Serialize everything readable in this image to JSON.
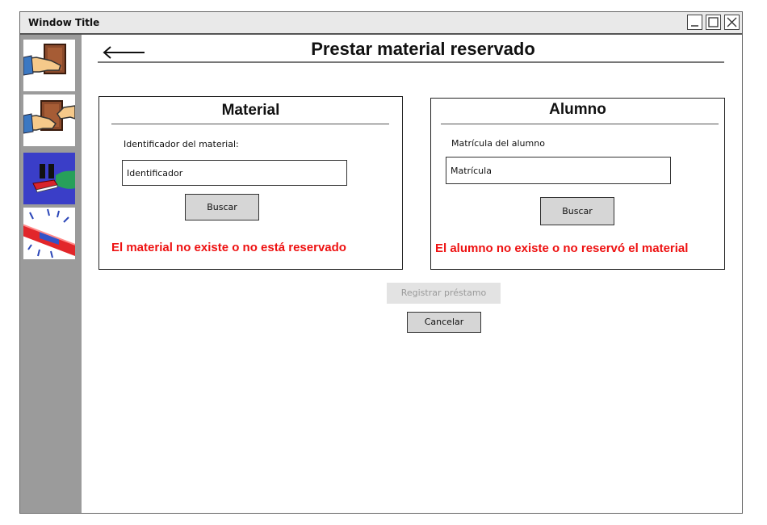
{
  "window": {
    "title": "Window Title"
  },
  "sidebar": {
    "items": [
      {
        "name": "lend-book-icon"
      },
      {
        "name": "return-book-icon"
      },
      {
        "name": "pause-book-icon"
      },
      {
        "name": "alert-siren-icon"
      }
    ]
  },
  "header": {
    "title": "Prestar material reservado"
  },
  "material_panel": {
    "title": "Material",
    "field_label": "Identificador del material:",
    "input_placeholder": "Identificador",
    "search_label": "Buscar",
    "error": "El material no existe o no está reservado"
  },
  "student_panel": {
    "title": "Alumno",
    "field_label": "Matrícula del alumno",
    "input_placeholder": "Matrícula",
    "search_label": "Buscar",
    "error": "El alumno no existe o no reservó el material"
  },
  "actions": {
    "register_label": "Registrar préstamo",
    "cancel_label": "Cancelar"
  },
  "colors": {
    "error": "#ee1111",
    "sidebar": "#9b9b9b",
    "button": "#d6d6d6"
  }
}
